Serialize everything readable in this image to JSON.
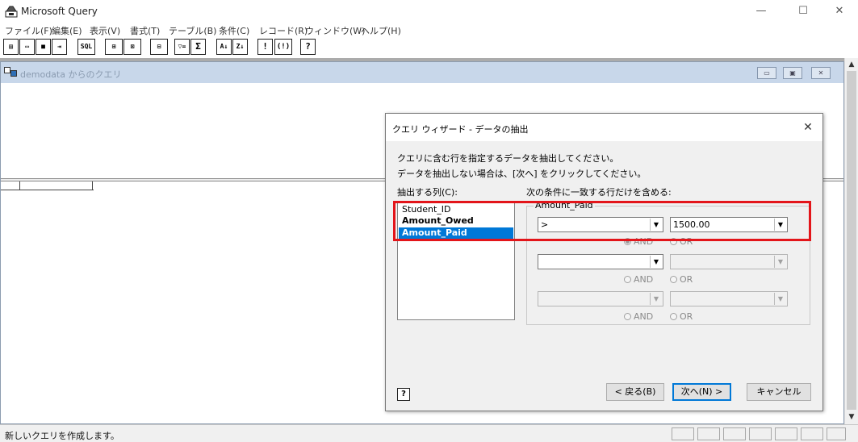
{
  "app": {
    "title": "Microsoft Query",
    "window_controls": {
      "minimize": "—",
      "maximize": "☐",
      "close": "✕"
    }
  },
  "menu": [
    "ファイル(F)",
    "編集(E)",
    "表示(V)",
    "書式(T)",
    "テーブル(B)",
    "条件(C)",
    "レコード(R)",
    "ウィンドウ(W)",
    "ヘルプ(H)"
  ],
  "toolbar": {
    "sql_label": "SQL",
    "sum_label": "Σ",
    "run_label": "!",
    "auto_label": "(!)",
    "help_label": "?"
  },
  "query_window": {
    "title": "demodata からのクエリ",
    "controls": {
      "minimize": "▭",
      "restore": "▣",
      "close": "✕"
    }
  },
  "status_bar": {
    "text": "新しいクエリを作成します。"
  },
  "dialog": {
    "title": "クエリ ウィザード - データの抽出",
    "close": "✕",
    "instruction1": "クエリに含む行を指定するデータを抽出してください。",
    "instruction2": "データを抽出しない場合は、[次へ] をクリックしてください。",
    "columns_label": "抽出する列(C):",
    "columns": [
      "Student_ID",
      "Amount_Owed",
      "Amount_Paid"
    ],
    "selected_column": "Amount_Paid",
    "conditions_label": "次の条件に一致する行だけを含める:",
    "group_label": "Amount_Paid",
    "row1": {
      "operator": ">",
      "value": "1500.00"
    },
    "and_label": "AND",
    "or_label": "OR",
    "help_label": "?",
    "buttons": {
      "back": "< 戻る(B)",
      "next": "次へ(N) >",
      "cancel": "キャンセル"
    }
  },
  "colors": {
    "highlight": "#e3151a",
    "selection": "#0078d7",
    "workspace": "#ababab"
  }
}
